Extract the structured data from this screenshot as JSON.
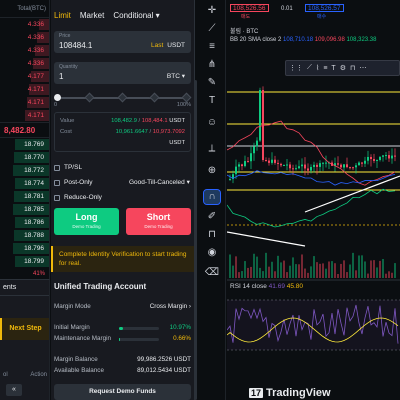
{
  "orderbook": {
    "header": "Total(BTC)",
    "asks": [
      "4.336",
      "4.336",
      "4.336",
      "4.336",
      "4.177",
      "4.171",
      "4.171",
      "4.171"
    ],
    "mid_price": "8,482.80",
    "bids": [
      "18.769",
      "18.770",
      "18.772",
      "18.774",
      "18.781",
      "18.785",
      "18.786",
      "18.788",
      "18.796",
      "18.799"
    ],
    "ratio": "41%",
    "bottom_tab": "ents",
    "next_step": "Next Step",
    "foot_left": "ol",
    "foot_right": "Action",
    "control_glyph": "«"
  },
  "order_form": {
    "tabs": [
      "Limit",
      "Market",
      "Conditional"
    ],
    "price_label": "Price",
    "price_value": "108484.1",
    "price_last": "Last",
    "price_unit": "USDT",
    "qty_label": "Quantity",
    "qty_value": "1",
    "qty_unit": "BTC",
    "slider_min": "0",
    "slider_max": "100%",
    "slider_fill": 0,
    "value_label": "Value",
    "value_buy": "108,482.9",
    "value_sep": "/",
    "value_sell": "108,484.1",
    "value_unit": "USDT",
    "cost_label": "Cost",
    "cost_buy": "10,961.6647",
    "cost_sep": "/",
    "cost_sell": "10,973.7092",
    "cost_unit": "USDT",
    "tpsl": "TP/SL",
    "post_only": "Post-Only",
    "tif": "Good-Till-Canceled",
    "reduce_only": "Reduce-Only",
    "long_label": "Long",
    "long_sub": "Demo Trading",
    "short_label": "Short",
    "short_sub": "Demo Trading",
    "banner": "Complete Identity Verification to start trading for real.",
    "account_title": "Unified Trading Account",
    "margin_mode_label": "Margin Mode",
    "margin_mode_value": "Cross Margin",
    "initial_margin_label": "Initial Margin",
    "initial_margin_value": "10.97%",
    "initial_margin_fill": 0.1097,
    "maint_margin_label": "Maintenance Margin",
    "maint_margin_value": "0.66%",
    "maint_margin_fill": 0.0066,
    "margin_balance_label": "Margin Balance",
    "margin_balance_value": "99,986.2526 USDT",
    "available_balance_label": "Available Balance",
    "available_balance_value": "89,012.5434 USDT",
    "request_button": "Request Demo Funds"
  },
  "chart": {
    "sell_price": "108,526.56",
    "sell_sub": "매도",
    "spread": "0.01",
    "buy_price": "108,526.57",
    "buy_sub": "매수",
    "title": "불림 · BTC",
    "bb_label": "BB 20 SMA close 2",
    "bb_v1": "108,710.18",
    "bb_v2": "109,096.98",
    "bb_v3": "108,323.38",
    "rsi_label": "RSI 14 close",
    "rsi_v1": "41.69",
    "rsi_v2": "45.80",
    "logo": "TradingView",
    "logo_mark": "17",
    "colors": {
      "up": "#0ecb81",
      "down": "#f6465d",
      "accent": "#f0b90b",
      "bb": "#2962ff",
      "rsi": "#7e57c2",
      "support": "#ffeb3b"
    }
  },
  "toolbar_icons": [
    "crosshair-icon",
    "trend-line-icon",
    "fib-icon",
    "pitchfork-icon",
    "brush-icon",
    "text-icon",
    "emoji-icon",
    "ruler-icon",
    "zoom-icon",
    "magnet-icon",
    "lock-drawings-icon",
    "lock-icon",
    "eye-icon",
    "trash-icon"
  ]
}
